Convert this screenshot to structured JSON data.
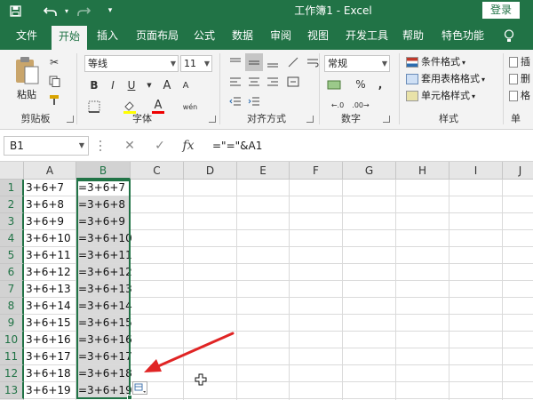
{
  "titlebar": {
    "title": "工作簿1 - Excel",
    "login_label": "登录",
    "save_icon": "save-icon",
    "undo_icon": "undo-icon",
    "redo_icon": "redo-icon",
    "customize_icon": "customize-icon"
  },
  "tabs": [
    "文件",
    "开始",
    "插入",
    "页面布局",
    "公式",
    "数据",
    "审阅",
    "视图",
    "开发工具",
    "帮助",
    "特色功能"
  ],
  "active_tab": "开始",
  "tell_me_icon": "lightbulb-icon",
  "ribbon": {
    "clipboard": {
      "label": "剪贴板",
      "paste_label": "粘贴"
    },
    "font": {
      "label": "字体",
      "font_name": "等线",
      "font_size": "11",
      "bold": "B",
      "italic": "I",
      "underline": "U",
      "grow": "A",
      "shrink": "A",
      "font_color_letter": "A",
      "phonetic": "wén"
    },
    "alignment": {
      "label": "对齐方式"
    },
    "number": {
      "label": "数字",
      "format": "常规",
      "percent": "%",
      "comma": ","
    },
    "styles": {
      "label": "样式",
      "conditional": "条件格式",
      "table": "套用表格格式",
      "cell_styles": "单元格样式"
    },
    "cells": {
      "label": "单",
      "insert": "插",
      "delete": "删",
      "format": "格"
    }
  },
  "formula_bar": {
    "name_box": "B1",
    "cancel": "✕",
    "enter": "✓",
    "fx": "fx",
    "formula": "=\"=\"&A1"
  },
  "sheet": {
    "columns": [
      "A",
      "B",
      "C",
      "D",
      "E",
      "F",
      "G",
      "H",
      "I",
      "J"
    ],
    "selected_column": "B",
    "rows": [
      "1",
      "2",
      "3",
      "4",
      "5",
      "6",
      "7",
      "8",
      "9",
      "10",
      "11",
      "12",
      "13",
      "14"
    ],
    "col_a": [
      "3+6+7",
      "3+6+8",
      "3+6+9",
      "3+6+10",
      "3+6+11",
      "3+6+12",
      "3+6+13",
      "3+6+14",
      "3+6+15",
      "3+6+16",
      "3+6+17",
      "3+6+18",
      "3+6+19",
      ""
    ],
    "col_b": [
      "=3+6+7",
      "=3+6+8",
      "=3+6+9",
      "=3+6+10",
      "=3+6+11",
      "=3+6+12",
      "=3+6+13",
      "=3+6+14",
      "=3+6+15",
      "=3+6+16",
      "=3+6+17",
      "=3+6+18",
      "=3+6+19",
      ""
    ]
  },
  "colors": {
    "excel_green": "#217346",
    "annotation_arrow": "#e02424"
  }
}
